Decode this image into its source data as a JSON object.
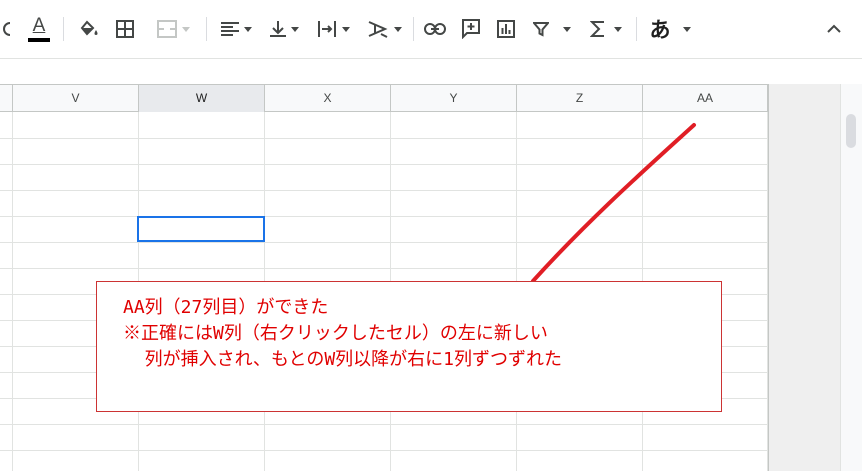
{
  "toolbar": {
    "text_color_glyph": "A",
    "text_color_bar_color": "#000000",
    "input_tools_label": "あ",
    "icons": [
      "undo-icon",
      "text-color-icon",
      "fill-color-icon",
      "borders-icon",
      "merge-cells-icon",
      "horizontal-align-icon",
      "vertical-align-icon",
      "text-wrapping-icon",
      "text-rotation-icon",
      "insert-link-icon",
      "insert-comment-icon",
      "insert-chart-icon",
      "filter-icon",
      "functions-icon",
      "input-tools-icon",
      "collapse-menus-icon"
    ]
  },
  "sheet": {
    "columns": [
      "V",
      "W",
      "X",
      "Y",
      "Z",
      "AA"
    ],
    "selected_column": "W",
    "active_cell_color": "#1a73e8"
  },
  "annotation": {
    "line1": "AA列（27列目）ができた",
    "line2": "※正確にはW列（右クリックしたセル）の左に新しい",
    "line3": "  列が挿入され、もとのW列以降が右に1列ずつずれた",
    "text_color": "#e00000",
    "arrow_color": "#e01e25"
  }
}
